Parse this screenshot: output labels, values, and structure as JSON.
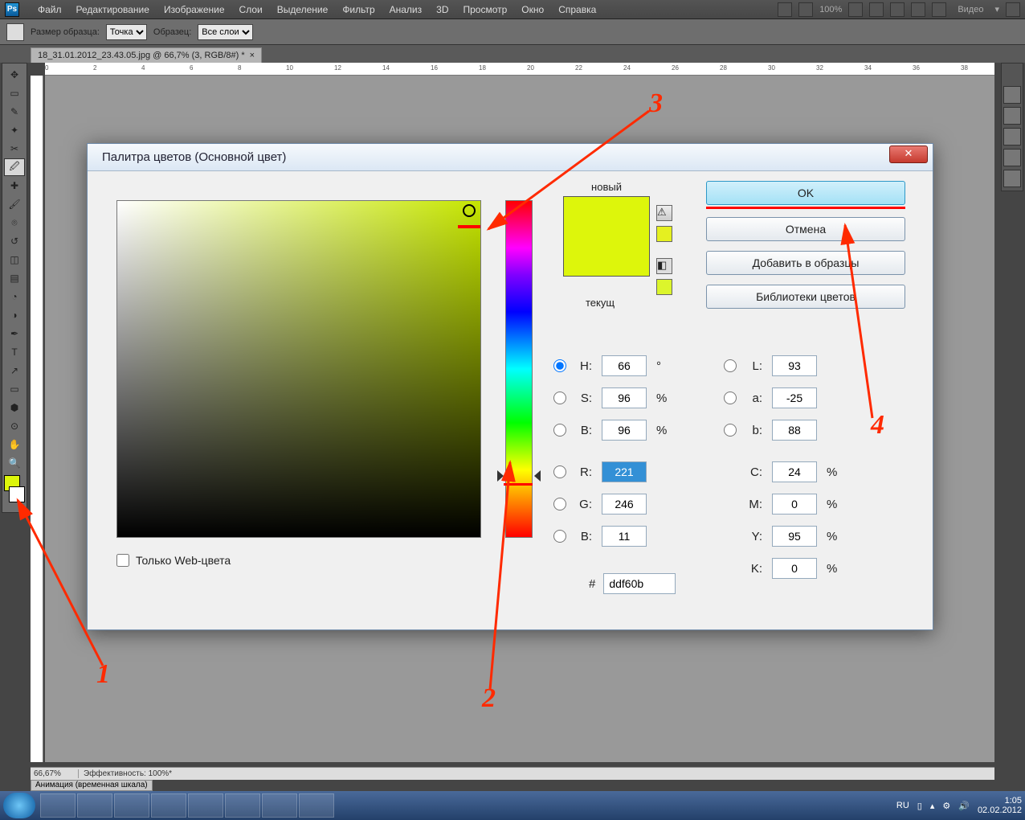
{
  "menu": {
    "items": [
      "Файл",
      "Редактирование",
      "Изображение",
      "Слои",
      "Выделение",
      "Фильтр",
      "Анализ",
      "3D",
      "Просмотр",
      "Окно",
      "Справка"
    ],
    "zoom_display": "100%",
    "video_label": "Видео"
  },
  "options": {
    "tool_name": "Пипетка",
    "sample_size_label": "Размер образца:",
    "sample_size_value": "Точка",
    "sample_label": "Образец:",
    "sample_value": "Все слои"
  },
  "document": {
    "tab_title": "18_31.01.2012_23.43.05.jpg @ 66,7% (3, RGB/8#) *",
    "ruler_marks": [
      "0",
      "2",
      "4",
      "6",
      "8",
      "10",
      "12",
      "14",
      "16",
      "18",
      "20",
      "22",
      "24",
      "26",
      "28",
      "30",
      "32",
      "34",
      "36",
      "38"
    ]
  },
  "status": {
    "zoom": "66,67%",
    "efficiency": "Эффективность: 100%*",
    "anim_tab": "Анимация (временная шкала)"
  },
  "dialog": {
    "title": "Палитра цветов (Основной цвет)",
    "new_label": "новый",
    "current_label": "текущ",
    "ok": "OK",
    "cancel": "Отмена",
    "add_swatch": "Добавить в образцы",
    "libraries": "Библиотеки цветов",
    "web_only": "Только Web-цвета",
    "hex_value": "ddf60b",
    "hsb": {
      "H": "66",
      "S": "96",
      "B": "96"
    },
    "rgb": {
      "R": "221",
      "G": "246",
      "B": "11"
    },
    "lab": {
      "L": "93",
      "a": "-25",
      "b": "88"
    },
    "cmyk": {
      "C": "24",
      "M": "0",
      "Y": "95",
      "K": "0"
    },
    "new_color": "#ddf60b",
    "current_color": "#ddf60b"
  },
  "annotations": {
    "n1": "1",
    "n2": "2",
    "n3": "3",
    "n4": "4"
  },
  "taskbar": {
    "lang": "RU",
    "time": "1:05",
    "date": "02.02.2012"
  }
}
